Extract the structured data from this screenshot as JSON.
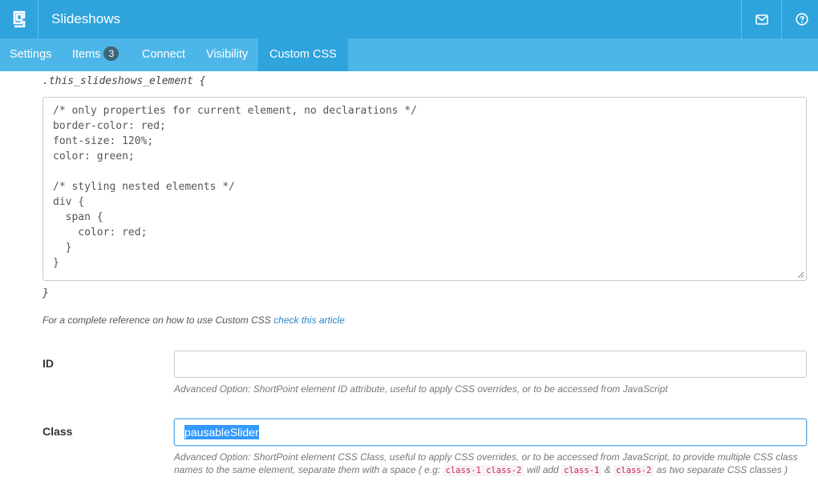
{
  "header": {
    "title": "Slideshows",
    "icons": {
      "logo": "shortpoint-logo-icon",
      "mail": "mail-icon",
      "help": "help-circle-icon"
    }
  },
  "tabs": [
    {
      "label": "Settings"
    },
    {
      "label": "Items",
      "badge": "3"
    },
    {
      "label": "Connect"
    },
    {
      "label": "Visibility"
    },
    {
      "label": "Custom CSS",
      "active": true
    }
  ],
  "css_editor": {
    "selector_open": ".this_slideshows_element {",
    "selector_close": "}",
    "code_lines": [
      "/* only properties for current element, no declarations */",
      "border-color: red;",
      "font-size: 120%;",
      "color: green;",
      "",
      "/* styling nested elements */",
      "div {",
      "  span {",
      "    color: red;",
      "  }",
      "}"
    ],
    "reference_text": "For a complete reference on how to use Custom CSS",
    "reference_link": "check this article"
  },
  "id_field": {
    "label": "ID",
    "value": "",
    "help": "Advanced Option: ShortPoint element ID attribute, useful to apply CSS overrides, or to be accessed from JavaScript"
  },
  "class_field": {
    "label": "Class",
    "value": "pausableSlider",
    "help_part1": "Advanced Option: ShortPoint element CSS Class, useful to apply CSS overrides, or to be accessed from JavaScript, to provide multiple CSS class names to the same element, separate them with a space ( e.g:",
    "help_code1": "class-1 class-2",
    "help_part2": "will add",
    "help_code2": "class-1",
    "help_amp": "&",
    "help_code3": "class-2",
    "help_part3": "as two separate CSS classes )"
  },
  "colors": {
    "header_bg": "#2ea3dc",
    "tabbar_bg": "#4db6e8",
    "active_tab_bg": "#2ea3dc",
    "badge_bg": "#3d6678",
    "link": "#2a86c8",
    "selection": "#3399ff"
  }
}
